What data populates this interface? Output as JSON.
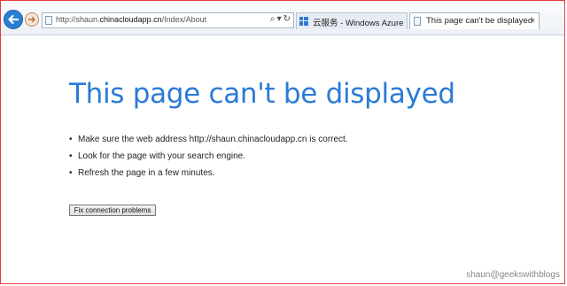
{
  "browser": {
    "address_bar": {
      "url_prefix": "http://shaun.",
      "url_host": "chinacloudapp.cn",
      "url_path": "/Index/About",
      "search_icon": "⌕",
      "dropdown_icon": "▾",
      "refresh_icon": "↻"
    },
    "tabs": [
      {
        "label": "云服务 - Windows Azure",
        "icon": "windows-icon",
        "active": false
      },
      {
        "label": "This page can't be displayed",
        "icon": "page-icon",
        "active": true,
        "close": "×"
      }
    ]
  },
  "content": {
    "title": "This page can't be displayed",
    "bullets": [
      "Make sure the web address http://shaun.chinacloudapp.cn is correct.",
      "Look for the page with your search engine.",
      "Refresh the page in a few minutes."
    ],
    "fix_button": "Fix connection problems"
  },
  "watermark": "shaun@geekswithblogs",
  "colors": {
    "title": "#2b7bd6",
    "back_button": "#2a7fd4",
    "frame_border": "#e33b3b"
  }
}
